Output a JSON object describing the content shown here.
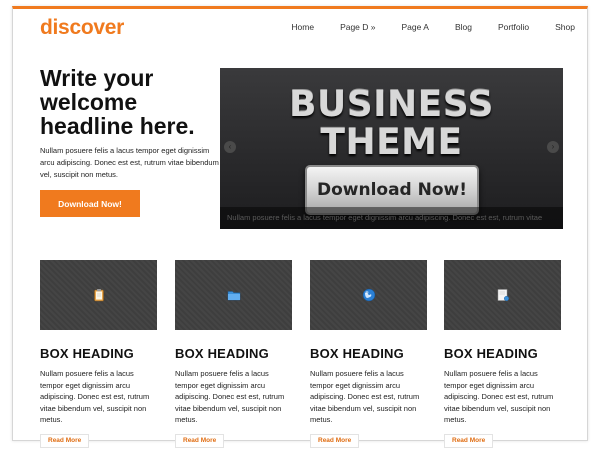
{
  "header": {
    "logo": "discover",
    "nav": [
      "Home",
      "Page D »",
      "Page A",
      "Blog",
      "Portfolio",
      "Shop"
    ]
  },
  "welcome": {
    "headline": "Write your welcome headline here.",
    "text": "Nullam posuere felis a lacus tempor eget dignissim arcu adipiscing. Donec est est, rutrum vitae bibendum vel, suscipit non metus.",
    "button": "Download Now!"
  },
  "slider": {
    "title_line1": "BUSINESS",
    "title_line2": "THEME",
    "cta": "Download Now!",
    "caption": "Nullam posuere felis a lacus tempor eget dignissim arcu adipiscing. Donec est est, rutrum vitae bibendum vel, suscipit non metus.",
    "prev_icon": "‹",
    "next_icon": "›"
  },
  "boxes": [
    {
      "icon": "clipboard-icon",
      "heading": "BOX HEADING",
      "text": "Nullam posuere felis a lacus tempor eget dignissim arcu adipiscing. Donec est est, rutrum vitae bibendum vel, suscipit non metus.",
      "link": "Read More"
    },
    {
      "icon": "folder-icon",
      "heading": "BOX HEADING",
      "text": "Nullam posuere felis a lacus tempor eget dignissim arcu adipiscing. Donec est est, rutrum vitae bibendum vel, suscipit non metus.",
      "link": "Read More"
    },
    {
      "icon": "globe-icon",
      "heading": "BOX HEADING",
      "text": "Nullam posuere felis a lacus tempor eget dignissim arcu adipiscing. Donec est est, rutrum vitae bibendum vel, suscipit non metus.",
      "link": "Read More"
    },
    {
      "icon": "document-icon",
      "heading": "BOX HEADING",
      "text": "Nullam posuere felis a lacus tempor eget dignissim arcu adipiscing. Donec est est, rutrum vitae bibendum vel, suscipit non metus.",
      "link": "Read More"
    }
  ],
  "colors": {
    "accent": "#f07a1e",
    "dark": "#3a3a3c"
  }
}
